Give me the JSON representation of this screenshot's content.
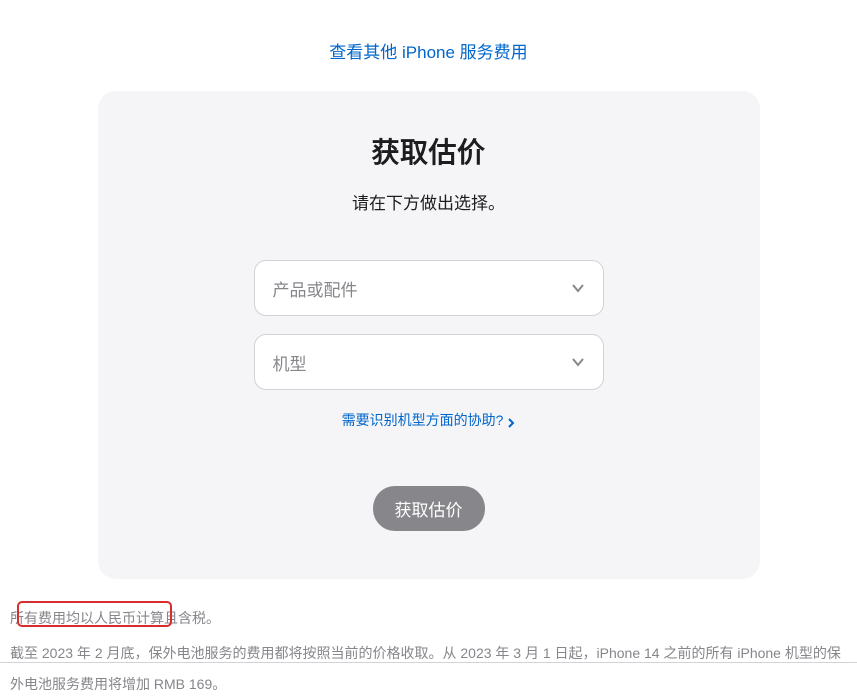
{
  "top_link": "查看其他 iPhone 服务费用",
  "card": {
    "title": "获取估价",
    "subtitle": "请在下方做出选择。",
    "select_product_placeholder": "产品或配件",
    "select_model_placeholder": "机型",
    "help_link": "需要识别机型方面的协助?",
    "submit_label": "获取估价"
  },
  "footnotes": {
    "line1": "所有费用均以人民币计算且含税。",
    "line2": "截至 2023 年 2 月底，保外电池服务的费用都将按照当前的价格收取。从 2023 年 3 月 1 日起，iPhone 14 之前的所有 iPhone 机型的保外电池服务费用将增加 RMB 169。"
  }
}
